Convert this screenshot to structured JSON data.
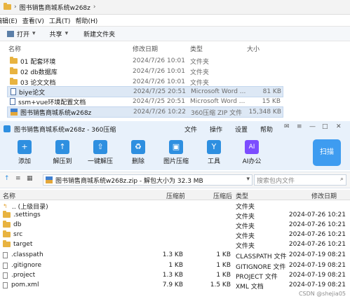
{
  "explorer": {
    "address_title": "图书销售商城系统w268z",
    "menu": [
      "编辑(E)",
      "查看(V)",
      "工具(T)",
      "帮助(H)"
    ],
    "toolbar": {
      "open": "打开",
      "share": "共享",
      "new_folder": "新建文件夹"
    },
    "columns": {
      "name": "名称",
      "date": "修改日期",
      "type": "类型",
      "size": "大小"
    },
    "files": [
      {
        "name": "01 配套环境",
        "date": "2024/7/26 10:01",
        "type": "文件夹",
        "size": "",
        "icon": "folder-icon"
      },
      {
        "name": "02 db数据库",
        "date": "2024/7/26 10:01",
        "type": "文件夹",
        "size": "",
        "icon": "folder-icon"
      },
      {
        "name": "03 论文文档",
        "date": "2024/7/26 10:01",
        "type": "文件夹",
        "size": "",
        "icon": "folder-icon"
      },
      {
        "name": "biye论文",
        "date": "2024/7/25 20:51",
        "type": "Microsoft Word ...",
        "size": "81 KB",
        "icon": "word-icon"
      },
      {
        "name": "ssm+vue环境配置文档",
        "date": "2024/7/25 20:51",
        "type": "Microsoft Word ...",
        "size": "15 KB",
        "icon": "word-icon"
      },
      {
        "name": "图书销售商城系统w268z",
        "date": "2024/7/26 10:22",
        "type": "360压缩 ZIP 文件",
        "size": "15,348 KB",
        "icon": "zip-icon"
      }
    ]
  },
  "zip": {
    "title": "图书销售商城系统w268z - 360压缩",
    "title_menu": [
      "文件",
      "操作",
      "设置",
      "帮助"
    ],
    "tools": [
      {
        "label": "添加",
        "icon": "add-icon",
        "glyph": "+"
      },
      {
        "label": "解压到",
        "icon": "extract-to-icon",
        "glyph": "↑"
      },
      {
        "label": "一键解压",
        "icon": "one-click-extract-icon",
        "glyph": "⇧"
      },
      {
        "label": "删除",
        "icon": "delete-icon",
        "glyph": "♻"
      },
      {
        "label": "图片压缩",
        "icon": "image-compress-icon",
        "glyph": "▣"
      },
      {
        "label": "工具",
        "icon": "tools-icon",
        "glyph": "Y"
      },
      {
        "label": "AI办公",
        "icon": "ai-office-icon",
        "glyph": "AI"
      }
    ],
    "scan_label": "扫描",
    "path": "图书销售商城系统w268z.zip - 解包大小为 32.3 MB",
    "search_placeholder": "搜索包内文件",
    "columns": {
      "name": "名称",
      "original": "压缩前",
      "compressed": "压缩后",
      "type": "类型",
      "modified": "修改日期"
    },
    "files": [
      {
        "name": ".. (上级目录)",
        "original": "",
        "compressed": "",
        "type": "文件夹",
        "modified": "",
        "icon": "up-folder-icon"
      },
      {
        "name": ".settings",
        "original": "",
        "compressed": "",
        "type": "文件夹",
        "modified": "2024-07-26 10:21",
        "icon": "folder-icon"
      },
      {
        "name": "db",
        "original": "",
        "compressed": "",
        "type": "文件夹",
        "modified": "2024-07-26 10:21",
        "icon": "folder-icon"
      },
      {
        "name": "src",
        "original": "",
        "compressed": "",
        "type": "文件夹",
        "modified": "2024-07-26 10:21",
        "icon": "folder-icon"
      },
      {
        "name": "target",
        "original": "",
        "compressed": "",
        "type": "文件夹",
        "modified": "2024-07-26 10:21",
        "icon": "folder-icon"
      },
      {
        "name": ".classpath",
        "original": "1.3 KB",
        "compressed": "1 KB",
        "type": "CLASSPATH 文件",
        "modified": "2024-07-19 08:21",
        "icon": "file-icon"
      },
      {
        "name": ".gitignore",
        "original": "1 KB",
        "compressed": "1 KB",
        "type": "GITIGNORE 文件",
        "modified": "2024-07-19 08:21",
        "icon": "file-icon"
      },
      {
        "name": ".project",
        "original": "1.3 KB",
        "compressed": "1 KB",
        "type": "PROJECT 文件",
        "modified": "2024-07-19 08:21",
        "icon": "file-icon"
      },
      {
        "name": "pom.xml",
        "original": "7.9 KB",
        "compressed": "1.5 KB",
        "type": "XML 文档",
        "modified": "2024-07-19 08:21",
        "icon": "file-icon"
      }
    ],
    "watermark": "CSDN @shejia05"
  }
}
